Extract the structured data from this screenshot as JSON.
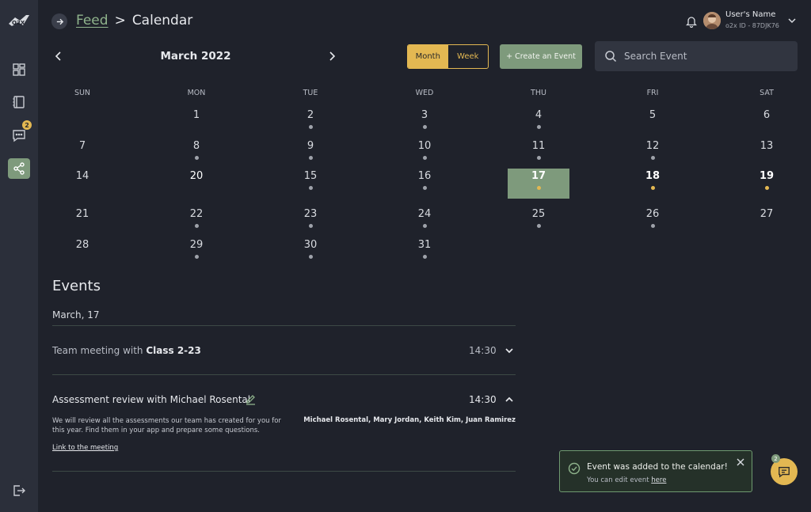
{
  "header": {
    "breadcrumb_link": "Feed",
    "breadcrumb_sep": ">",
    "breadcrumb_current": "Calendar",
    "user_name": "User's Name",
    "user_id": "o2x ID - 87DJK76"
  },
  "sidebar": {
    "messages_badge": "2"
  },
  "calendar": {
    "month_label": "March 2022",
    "view_month": "Month",
    "view_week": "Week",
    "create_label": "+ Create an Event",
    "search_placeholder": "Search Event",
    "days_of_week": [
      "SUN",
      "MON",
      "TUE",
      "WED",
      "THU",
      "FRI",
      "SAT"
    ],
    "weeks": [
      [
        "",
        "1",
        "2",
        "3",
        "4",
        "5",
        "6"
      ],
      [
        "7",
        "8",
        "9",
        "10",
        "11",
        "12",
        "13"
      ],
      [
        "14",
        "20",
        "15",
        "16",
        "17",
        "18",
        "19"
      ],
      [
        "21",
        "22",
        "23",
        "24",
        "25",
        "26",
        "27"
      ],
      [
        "28",
        "29",
        "30",
        "31",
        "",
        "",
        ""
      ]
    ],
    "selected_day": "17",
    "accent": "#7e9a7c",
    "highlight": "#e3b852"
  },
  "events": {
    "title": "Events",
    "date": "March, 17",
    "items": [
      {
        "title_prefix": "Team meeting with ",
        "title_bold": "Class 2-23",
        "time": "14:30",
        "expanded": false
      },
      {
        "title": "Assessment review with Michael Rosental",
        "time": "14:30",
        "expanded": true,
        "description": "We will review all the assessments our team has created for you for this year. Find them in your app and prepare some questions.",
        "people": "Michael Rosental, Mary Jordan, Keith Kim, Juan Ramirez",
        "link": "Link to the meeting"
      }
    ]
  },
  "toast": {
    "title": "Event was added to the calendar!",
    "sub_prefix": "You can edit event ",
    "sub_link": "here"
  },
  "chat": {
    "badge": "2"
  }
}
